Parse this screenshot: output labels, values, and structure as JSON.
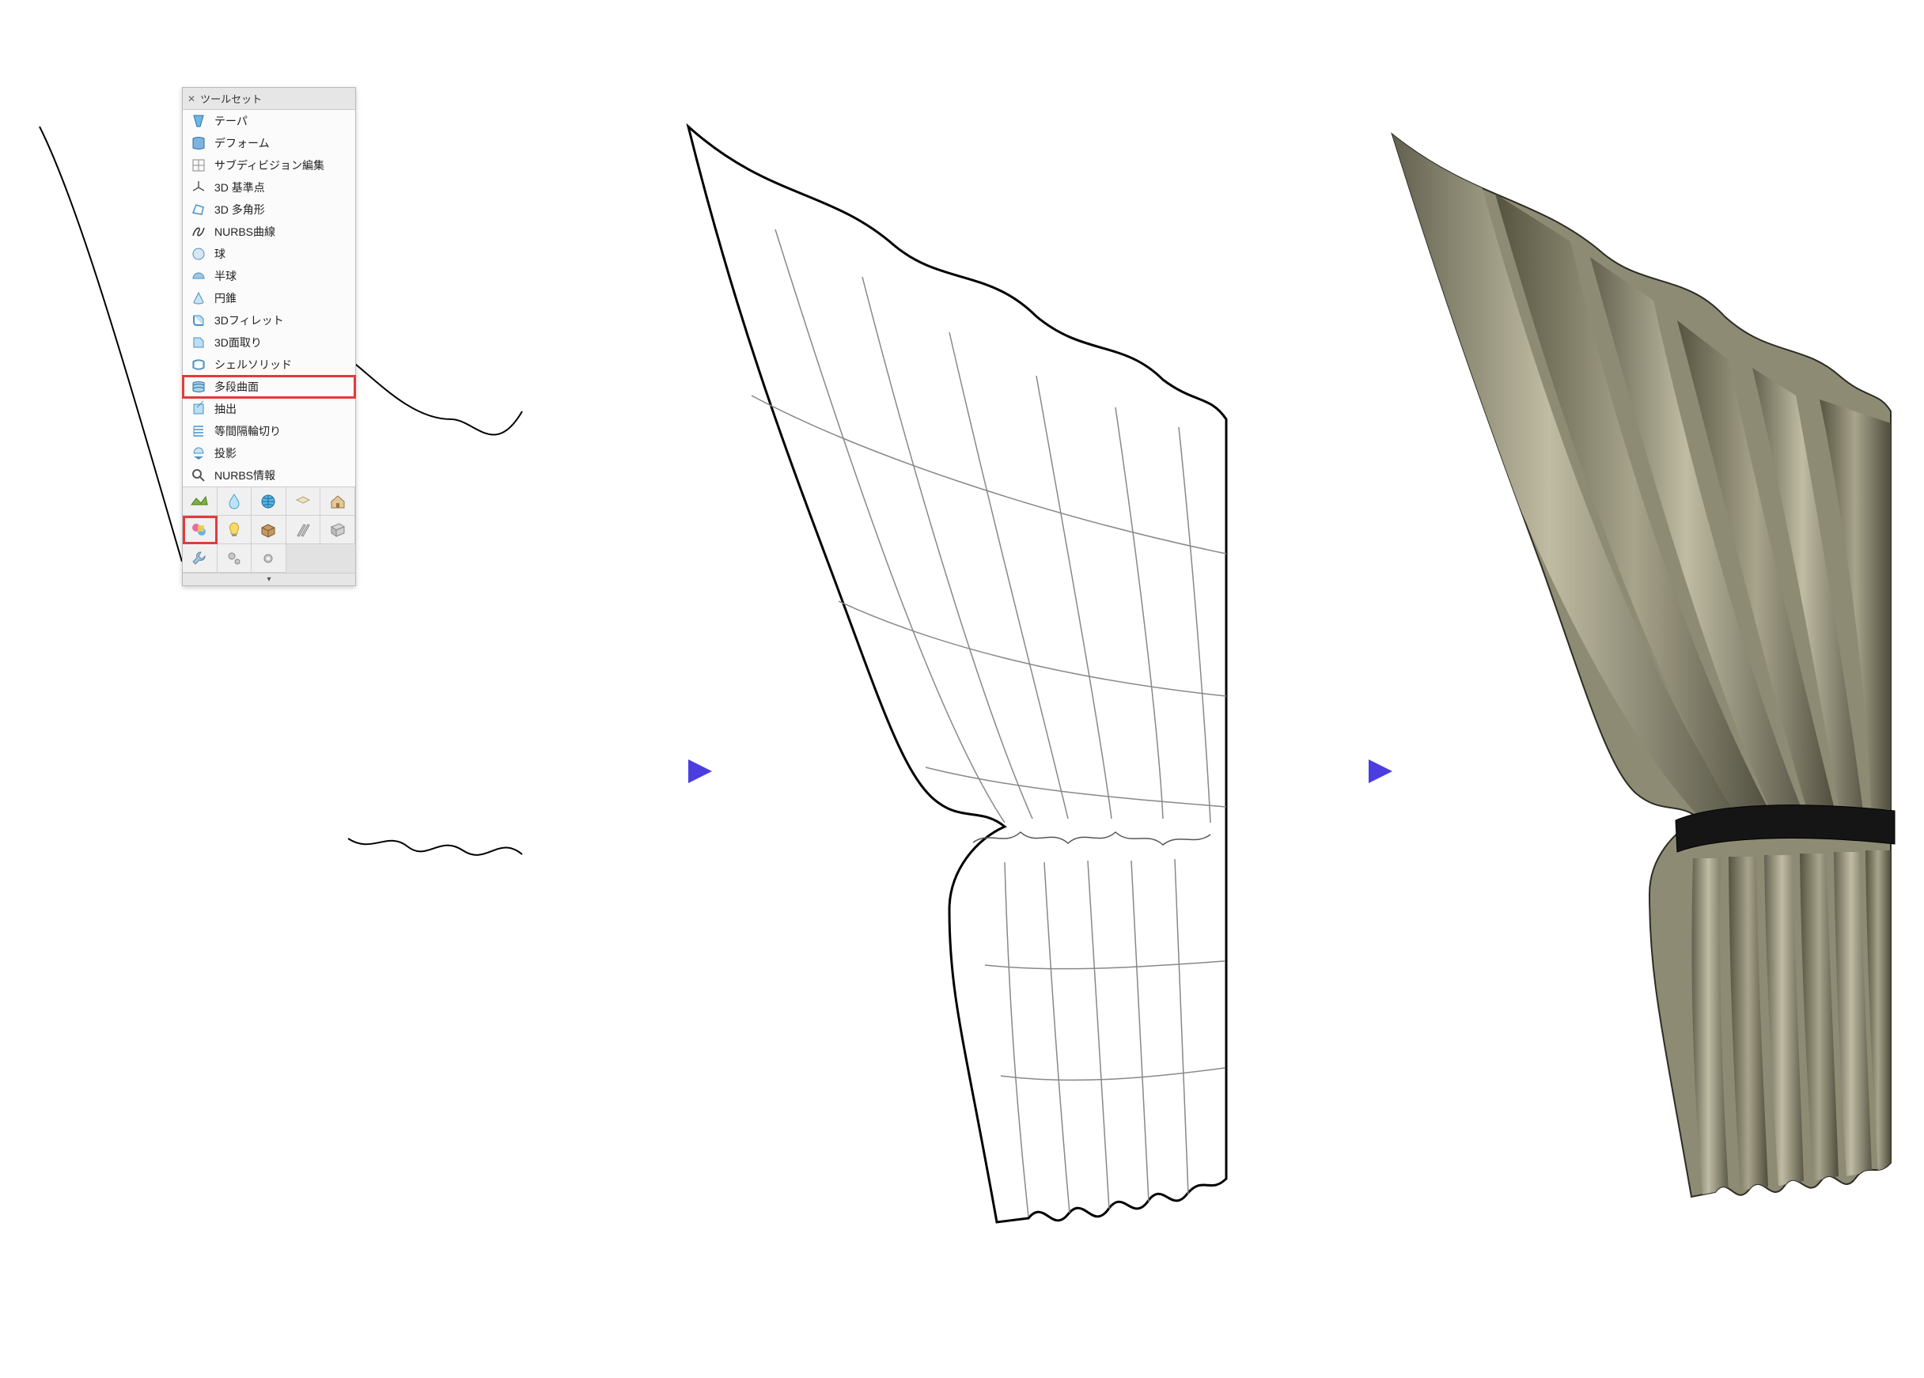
{
  "palette": {
    "title": "ツールセット",
    "tools": [
      {
        "label": "テーパ",
        "icon": "taper"
      },
      {
        "label": "デフォーム",
        "icon": "deform"
      },
      {
        "label": "サブディビジョン編集",
        "icon": "subdiv"
      },
      {
        "label": "3D 基準点",
        "icon": "datum3d"
      },
      {
        "label": "3D 多角形",
        "icon": "poly3d"
      },
      {
        "label": "NURBS曲線",
        "icon": "nurbscurve"
      },
      {
        "label": "球",
        "icon": "sphere"
      },
      {
        "label": "半球",
        "icon": "hemisphere"
      },
      {
        "label": "円錐",
        "icon": "cone"
      },
      {
        "label": "3Dフィレット",
        "icon": "fillet3d"
      },
      {
        "label": "3D面取り",
        "icon": "chamfer3d"
      },
      {
        "label": "シェルソリッド",
        "icon": "shell"
      },
      {
        "label": "多段曲面",
        "icon": "loft",
        "highlight": true
      },
      {
        "label": "抽出",
        "icon": "extract"
      },
      {
        "label": "等間隔輪切り",
        "icon": "contour"
      },
      {
        "label": "投影",
        "icon": "project"
      },
      {
        "label": "NURBS情報",
        "icon": "nurbsinfo"
      }
    ],
    "grid_icons": [
      {
        "name": "site-icon",
        "c": "#7bb43a"
      },
      {
        "name": "drop-icon",
        "c": "#6abde6"
      },
      {
        "name": "globe-icon",
        "c": "#3fa0d8"
      },
      {
        "name": "tile-icon",
        "c": "#d8cba2"
      },
      {
        "name": "house-icon",
        "c": "#caa46e"
      },
      {
        "name": "shapes-icon",
        "c": "#e05a87",
        "highlight": true
      },
      {
        "name": "bulb-icon",
        "c": "#f2c44c"
      },
      {
        "name": "box-icon",
        "c": "#b48656"
      },
      {
        "name": "pencils-icon",
        "c": "#9aa0a6"
      },
      {
        "name": "sheet-icon",
        "c": "#9aa0a6"
      },
      {
        "name": "wrench-icon",
        "c": "#7aa7c7"
      },
      {
        "name": "gears-icon",
        "c": "#9aa0a6"
      },
      {
        "name": "gear2-icon",
        "c": "#9aa0a6"
      }
    ]
  },
  "colors": {
    "highlight": "#e23b3b",
    "arrow": "#4b3de0",
    "curtain_light": "#b5b29b",
    "curtain_dark": "#6d6a56",
    "tieback": "#1a1a1a"
  }
}
